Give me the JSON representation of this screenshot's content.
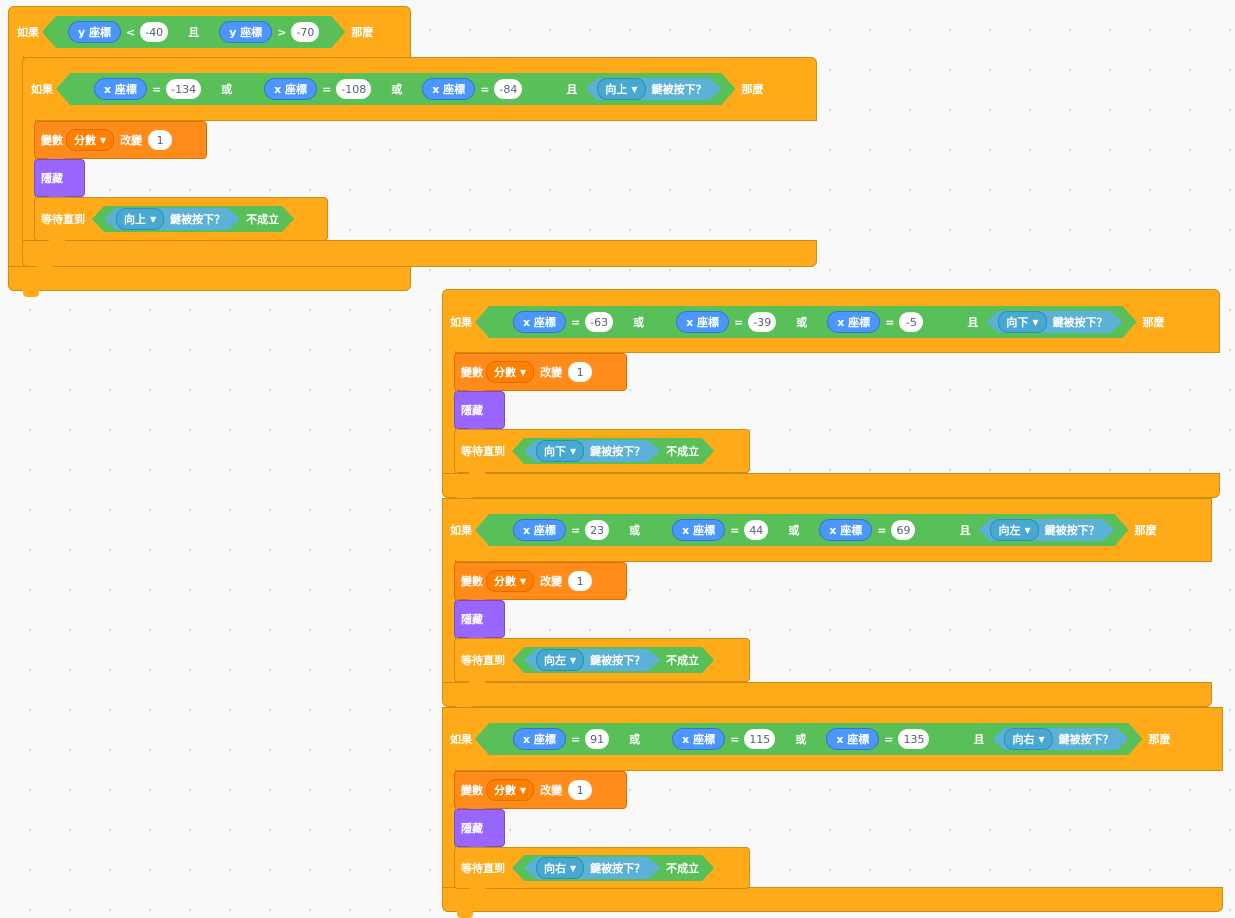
{
  "labels": {
    "if": "如果",
    "then": "那麼",
    "and": "且",
    "or": "或",
    "x_pos": "x 座標",
    "y_pos": "y 座標",
    "key_pressed": "鍵被按下？",
    "variable": "變數",
    "change_by": "改變",
    "hide": "隱藏",
    "wait_until": "等待直到",
    "not": "不成立",
    "lt": "<",
    "gt": ">",
    "eq": "="
  },
  "outer": {
    "y_lt": "-40",
    "y_gt": "-70"
  },
  "groups": [
    {
      "x": [
        "-134",
        "-108",
        "-84"
      ],
      "key": "向上",
      "var": "分數",
      "inc": "1"
    },
    {
      "x": [
        "-63",
        "-39",
        "-5"
      ],
      "key": "向下",
      "var": "分數",
      "inc": "1"
    },
    {
      "x": [
        "23",
        "44",
        "69"
      ],
      "key": "向左",
      "var": "分數",
      "inc": "1"
    },
    {
      "x": [
        "91",
        "115",
        "135"
      ],
      "key": "向右",
      "var": "分數",
      "inc": "1"
    }
  ],
  "colors": {
    "control": "#ffab19",
    "operators": "#59c059",
    "motion": "#4c97ff",
    "sensing": "#5cb1d6",
    "variables": "#ff8c1a",
    "looks": "#9966ff"
  }
}
